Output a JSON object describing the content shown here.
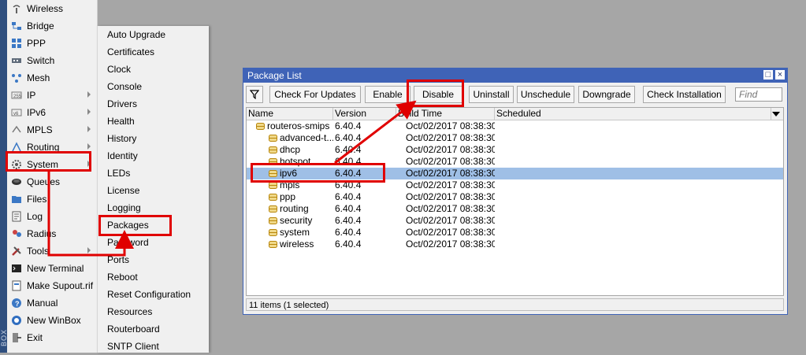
{
  "strip": {
    "label": "BOX"
  },
  "main_menu": {
    "items": [
      {
        "label": "Wireless",
        "icon": "wireless-icon",
        "arrow": false
      },
      {
        "label": "Bridge",
        "icon": "bridge-icon",
        "arrow": false
      },
      {
        "label": "PPP",
        "icon": "ppp-icon",
        "arrow": false
      },
      {
        "label": "Switch",
        "icon": "switch-icon",
        "arrow": false
      },
      {
        "label": "Mesh",
        "icon": "mesh-icon",
        "arrow": false
      },
      {
        "label": "IP",
        "icon": "ip-icon",
        "arrow": true
      },
      {
        "label": "IPv6",
        "icon": "ipv6-icon",
        "arrow": true
      },
      {
        "label": "MPLS",
        "icon": "mpls-icon",
        "arrow": true
      },
      {
        "label": "Routing",
        "icon": "routing-icon",
        "arrow": true
      },
      {
        "label": "System",
        "icon": "gear-icon",
        "arrow": true
      },
      {
        "label": "Queues",
        "icon": "queues-icon",
        "arrow": false
      },
      {
        "label": "Files",
        "icon": "folder-icon",
        "arrow": false
      },
      {
        "label": "Log",
        "icon": "log-icon",
        "arrow": false
      },
      {
        "label": "Radius",
        "icon": "radius-icon",
        "arrow": false
      },
      {
        "label": "Tools",
        "icon": "tools-icon",
        "arrow": true
      },
      {
        "label": "New Terminal",
        "icon": "terminal-icon",
        "arrow": false
      },
      {
        "label": "Make Supout.rif",
        "icon": "supout-icon",
        "arrow": false
      },
      {
        "label": "Manual",
        "icon": "manual-icon",
        "arrow": false
      },
      {
        "label": "New WinBox",
        "icon": "winbox-icon",
        "arrow": false
      },
      {
        "label": "Exit",
        "icon": "exit-icon",
        "arrow": false
      }
    ]
  },
  "system_submenu": {
    "items": [
      "Auto Upgrade",
      "Certificates",
      "Clock",
      "Console",
      "Drivers",
      "Health",
      "History",
      "Identity",
      "LEDs",
      "License",
      "Logging",
      "Packages",
      "Password",
      "Ports",
      "Reboot",
      "Reset Configuration",
      "Resources",
      "Routerboard",
      "SNTP Client"
    ]
  },
  "package_window": {
    "title": "Package List",
    "toolbar": {
      "filter_icon": "filter-icon",
      "buttons": [
        "Check For Updates",
        "Enable",
        "Disable",
        "Uninstall",
        "Unschedule",
        "Downgrade",
        "Check Installation"
      ],
      "find_placeholder": "Find"
    },
    "columns": [
      "Name",
      "Version",
      "Build Time",
      "Scheduled"
    ],
    "rows": [
      {
        "name": "routeros-smips",
        "version": "6.40.4",
        "build": "Oct/02/2017 08:38:30",
        "scheduled": "",
        "indent": 0,
        "selected": false
      },
      {
        "name": "advanced-t...",
        "version": "6.40.4",
        "build": "Oct/02/2017 08:38:30",
        "scheduled": "",
        "indent": 1,
        "selected": false
      },
      {
        "name": "dhcp",
        "version": "6.40.4",
        "build": "Oct/02/2017 08:38:30",
        "scheduled": "",
        "indent": 1,
        "selected": false
      },
      {
        "name": "hotspot",
        "version": "6.40.4",
        "build": "Oct/02/2017 08:38:30",
        "scheduled": "",
        "indent": 1,
        "selected": false
      },
      {
        "name": "ipv6",
        "version": "6.40.4",
        "build": "Oct/02/2017 08:38:30",
        "scheduled": "",
        "indent": 1,
        "selected": true
      },
      {
        "name": "mpls",
        "version": "6.40.4",
        "build": "Oct/02/2017 08:38:30",
        "scheduled": "",
        "indent": 1,
        "selected": false
      },
      {
        "name": "ppp",
        "version": "6.40.4",
        "build": "Oct/02/2017 08:38:30",
        "scheduled": "",
        "indent": 1,
        "selected": false
      },
      {
        "name": "routing",
        "version": "6.40.4",
        "build": "Oct/02/2017 08:38:30",
        "scheduled": "",
        "indent": 1,
        "selected": false
      },
      {
        "name": "security",
        "version": "6.40.4",
        "build": "Oct/02/2017 08:38:30",
        "scheduled": "",
        "indent": 1,
        "selected": false
      },
      {
        "name": "system",
        "version": "6.40.4",
        "build": "Oct/02/2017 08:38:30",
        "scheduled": "",
        "indent": 1,
        "selected": false
      },
      {
        "name": "wireless",
        "version": "6.40.4",
        "build": "Oct/02/2017 08:38:30",
        "scheduled": "",
        "indent": 1,
        "selected": false
      }
    ],
    "status": "11 items (1 selected)"
  },
  "colors": {
    "titlebar": "#3f63b7",
    "selection": "#9fbfe6",
    "annotation": "#e00000",
    "package_icon": "#b8860b"
  }
}
